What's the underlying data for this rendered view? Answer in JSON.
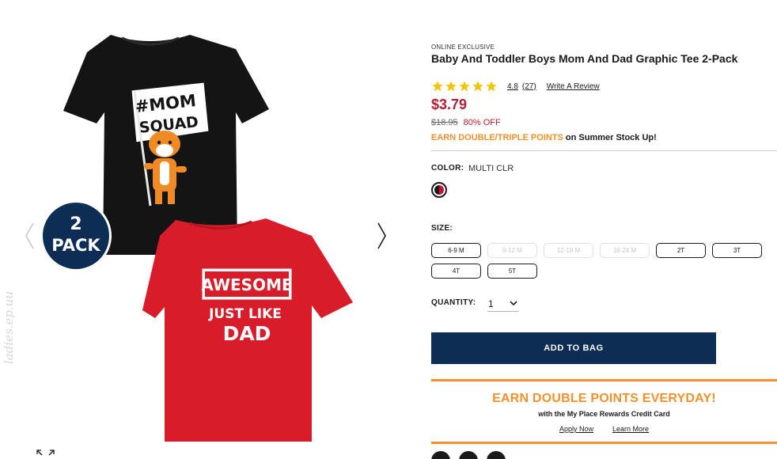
{
  "gallery": {
    "watermark": "ladies.ep.uu",
    "pack_badge": {
      "number": "2",
      "word": "PACK"
    },
    "shirt_top_text": [
      "#MOM",
      "SQUAD"
    ],
    "shirt_bottom_text": [
      "AWESOME",
      "JUST LIKE",
      "DAD"
    ],
    "colors": {
      "badge": "#0d2d54",
      "black_tee": "#141414",
      "red_tee": "#d71d2a",
      "tiger": "#f08a24"
    }
  },
  "product": {
    "badge": "ONLINE EXCLUSIVE",
    "title": "Baby And Toddler Boys Mom And Dad Graphic Tee 2-Pack",
    "rating": 4.8,
    "rating_text": "4.8",
    "review_count": "(27)",
    "write_review": "Write A Review",
    "price": "$3.79",
    "original_price": "$18.95",
    "discount": "80% OFF",
    "promo_highlight": "EARN DOUBLE/TRIPLE POINTS",
    "promo_rest": " on Summer Stock Up!",
    "star_color": "#f5c400",
    "price_color": "#b51d34"
  },
  "color": {
    "label": "COLOR:",
    "value": "MULTI CLR"
  },
  "size": {
    "label": "SIZE:",
    "options": [
      {
        "label": "6-9 M",
        "available": true
      },
      {
        "label": "9-12 M",
        "available": false
      },
      {
        "label": "12-18 M",
        "available": false
      },
      {
        "label": "18-24 M",
        "available": false
      },
      {
        "label": "2T",
        "available": true
      },
      {
        "label": "3T",
        "available": true
      },
      {
        "label": "4T",
        "available": true
      },
      {
        "label": "5T",
        "available": true
      }
    ]
  },
  "quantity": {
    "label": "QUANTITY:",
    "value": "1"
  },
  "cart": {
    "add_to_bag": "ADD TO BAG",
    "button_color": "#0d2d54"
  },
  "rewards": {
    "title": "EARN DOUBLE POINTS EVERYDAY!",
    "subtitle": "with the My Place Rewards Credit Card",
    "apply": "Apply Now",
    "learn": "Learn More",
    "accent": "#f0912b"
  },
  "social": {
    "icons": [
      "twitter-icon",
      "facebook-icon",
      "pinterest-icon"
    ]
  }
}
